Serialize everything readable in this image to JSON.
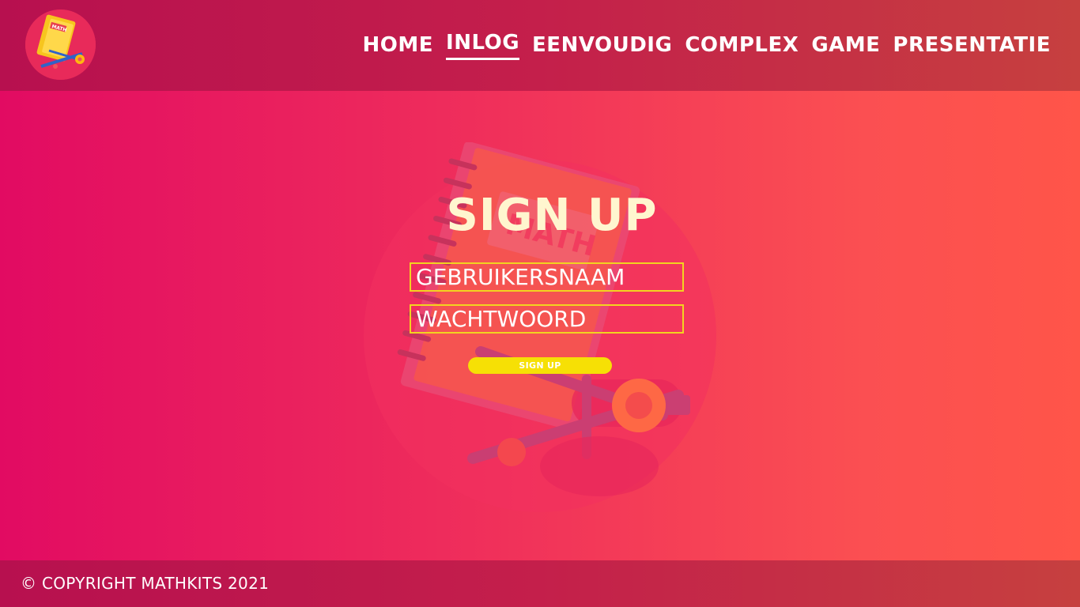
{
  "header": {
    "logo_icon": "math-book-compass-logo-icon",
    "logo_text": "MATH",
    "nav": [
      {
        "label": "HOME",
        "active": false
      },
      {
        "label": "INLOG",
        "active": true
      },
      {
        "label": "EENVOUDIG",
        "active": false
      },
      {
        "label": "COMPLEX",
        "active": false
      },
      {
        "label": "GAME",
        "active": false
      },
      {
        "label": "PRESENTATIE",
        "active": false
      }
    ]
  },
  "main": {
    "illustration_text": "MATH",
    "title": "SIGN UP",
    "username_placeholder": "GEBRUIKERSNAAM",
    "password_placeholder": "WACHTWOORD",
    "submit_label": "SIGN UP"
  },
  "footer": {
    "copyright": "© COPYRIGHT MATHKITS 2021"
  },
  "colors": {
    "accent": "#f6e005",
    "field_border": "#f2d320",
    "title": "#fff6cf",
    "header_bg": "#b7104f",
    "page_bg": "#e20b62"
  }
}
